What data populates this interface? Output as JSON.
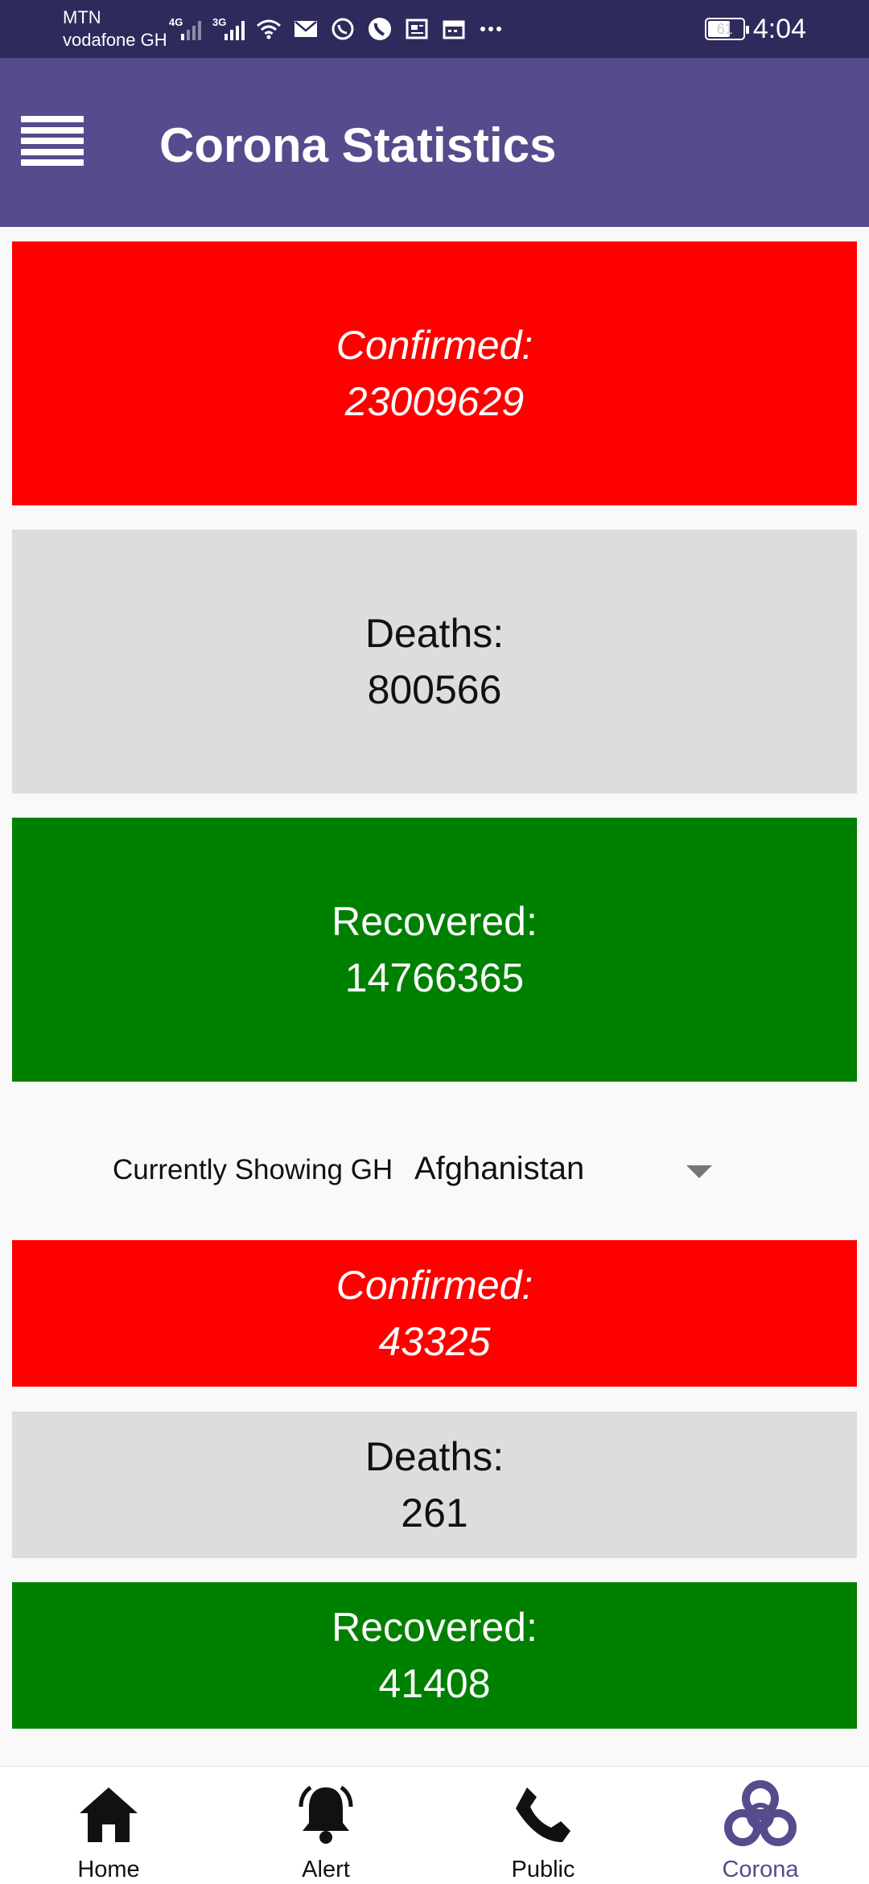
{
  "status_bar": {
    "carrier_1": "MTN",
    "carrier_2": "vodafone GH",
    "network_1": "4G",
    "network_2": "3G",
    "battery": "61",
    "time": "4:04",
    "icons": [
      "signal-icon",
      "wifi-icon",
      "mail-icon",
      "whatsapp-icon",
      "phone-icon",
      "news-icon",
      "calendar-icon",
      "more-icon"
    ]
  },
  "app_bar": {
    "title": "Corona Statistics",
    "menu_icon": "hamburger-menu-icon"
  },
  "global": {
    "confirmed_label": "Confirmed:",
    "confirmed_value": "23009629",
    "deaths_label": "Deaths:",
    "deaths_value": "800566",
    "recovered_label": "Recovered:",
    "recovered_value": "14766365"
  },
  "selector": {
    "label": "Currently Showing GH",
    "selected_country": "Afghanistan"
  },
  "country": {
    "confirmed_label": "Confirmed:",
    "confirmed_value": "43325",
    "deaths_label": "Deaths:",
    "deaths_value": "261",
    "recovered_label": "Recovered:",
    "recovered_value": "41408"
  },
  "bottom_nav": {
    "items": [
      {
        "label": "Home",
        "icon": "home-icon"
      },
      {
        "label": "Alert",
        "icon": "bell-icon"
      },
      {
        "label": "Public",
        "icon": "phone-icon"
      },
      {
        "label": "Corona",
        "icon": "biohazard-icon"
      }
    ],
    "active_index": 3
  },
  "colors": {
    "status_bar": "#2f2a5c",
    "app_bar": "#564b8d",
    "confirmed": "#ff0000",
    "deaths": "#dddddd",
    "recovered": "#008000",
    "nav_active": "#564b8d"
  }
}
